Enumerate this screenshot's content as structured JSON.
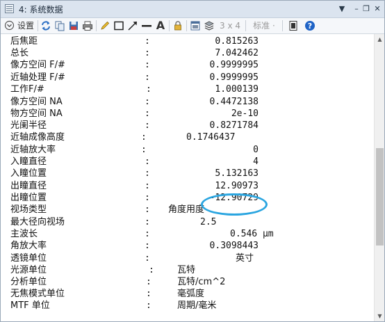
{
  "window": {
    "title": "4: 系统数据"
  },
  "toolbar": {
    "settings_label": "设置",
    "grid_label": "3 x 4 ·",
    "standard_label": "标准 ·"
  },
  "rows": [
    {
      "label": "后焦距",
      "value": "0.815263"
    },
    {
      "label": "总长",
      "value": "7.042462"
    },
    {
      "label": "像方空间 F/#",
      "value": "0.9999995"
    },
    {
      "label": "近轴处理 F/#",
      "value": "0.9999995"
    },
    {
      "label": "工作F/#",
      "value": "1.000139"
    },
    {
      "label": "像方空间 NA",
      "value": "0.4472138"
    },
    {
      "label": "物方空间 NA",
      "value": "2e-10"
    },
    {
      "label": "光阑半径",
      "value": "0.8271784"
    },
    {
      "label": "近轴成像高度",
      "value": "0.1746437"
    },
    {
      "label": "近轴放大率",
      "value": "0"
    },
    {
      "label": "入瞳直径",
      "value": "4"
    },
    {
      "label": "入瞳位置",
      "value": "5.132163"
    },
    {
      "label": "出瞳直径",
      "value": "12.90973"
    },
    {
      "label": "出瞳位置",
      "value": "-12.90729"
    },
    {
      "label": "视场类型",
      "value": "角度用度"
    },
    {
      "label": "最大径向视场",
      "value": "2.5"
    },
    {
      "label": "主波长",
      "value": "0.546 µm"
    },
    {
      "label": "角放大率",
      "value": "0.3098443"
    },
    {
      "label": "透镜单位",
      "value": "英寸"
    },
    {
      "label": "光源单位",
      "value": "瓦特"
    },
    {
      "label": "分析单位",
      "value": "瓦特/cm^2"
    },
    {
      "label": "无焦模式单位",
      "value": "毫弧度"
    },
    {
      "label": "MTF 单位",
      "value": "周期/毫米"
    }
  ]
}
